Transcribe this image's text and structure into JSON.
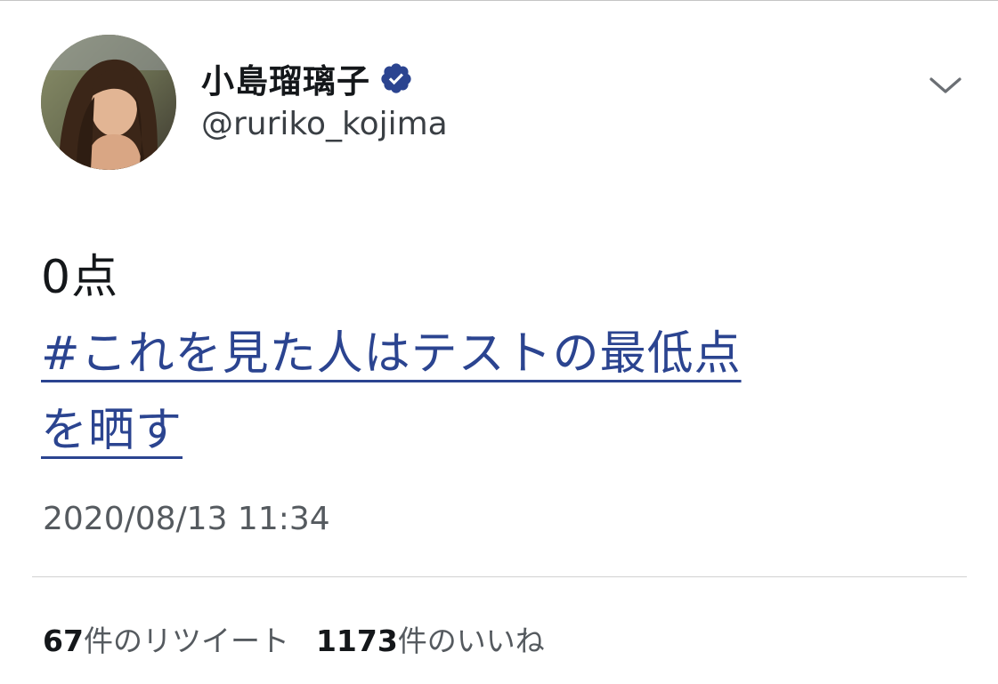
{
  "author": {
    "display_name": "小島瑠璃子",
    "handle": "@ruriko_kojima",
    "verified_icon": "verified-badge-icon",
    "verified_color": "#2b4490"
  },
  "tweet": {
    "text": "0点",
    "hashtag_line1": "#これを見た人はテストの最低点",
    "hashtag_line2": "を晒す",
    "timestamp": "2020/08/13 11:34"
  },
  "stats": {
    "retweets_count": "67",
    "retweets_label": "件のリツイート",
    "likes_count": "1173",
    "likes_label": "件のいいね"
  },
  "icons": {
    "more": "chevron-down-icon",
    "avatar": "avatar-photo"
  },
  "colors": {
    "link": "#2b4490",
    "text": "#14171a",
    "secondary_text": "#555a5f"
  }
}
